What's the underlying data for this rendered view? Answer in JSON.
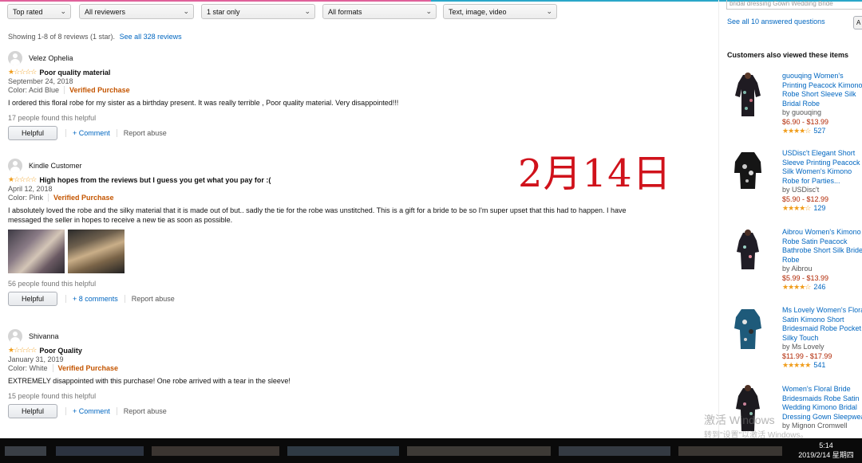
{
  "filters": [
    {
      "label": "Top rated"
    },
    {
      "label": "All reviewers"
    },
    {
      "label": "1 star only"
    },
    {
      "label": "All formats"
    },
    {
      "label": "Text, image, video"
    }
  ],
  "summary": {
    "text": "Showing 1-8 of 8 reviews (1 star).",
    "link": "See all 328 reviews"
  },
  "reviews": [
    {
      "name": "Velez Ophelia",
      "stars": "★☆☆☆☆",
      "title": "Poor quality material",
      "date": "September 24, 2018",
      "color": "Color: Acid Blue",
      "verified": "Verified Purchase",
      "body": "I ordered this floral robe for my sister as a birthday present. It was really terrible , Poor quality material. Very disappointed!!!",
      "helpful_count": "17 people found this helpful",
      "helpful_btn": "Helpful",
      "comment": "+ Comment",
      "report": "Report abuse"
    },
    {
      "name": "Kindle Customer",
      "stars": "★☆☆☆☆",
      "title": "High hopes from the reviews but I guess you get what you pay for :(",
      "date": "April 12, 2018",
      "color": "Color: Pink",
      "verified": "Verified Purchase",
      "body": "I absolutely loved the robe and the silky material that it is made out of but.. sadly the tie for the robe was unstitched. This is a gift for a bride to be so I'm super upset that this had to happen. I have messaged the seller in hopes to receive a new tie as soon as possible.",
      "helpful_count": "56 people found this helpful",
      "helpful_btn": "Helpful",
      "comment": "+ 8 comments",
      "report": "Report abuse"
    },
    {
      "name": "Shivanna",
      "stars": "★☆☆☆☆",
      "title": "Poor Quality",
      "date": "January 31, 2019",
      "color": "Color: White",
      "verified": "Verified Purchase",
      "body": "EXTREMELY disappointed with this purchase! One robe arrived with a tear in the sleeve!",
      "helpful_count": "15 people found this helpful",
      "helpful_btn": "Helpful",
      "comment": "+ Comment",
      "report": "Report abuse"
    }
  ],
  "overlay_date": "2月14日",
  "sidebar": {
    "question_snippet": "bridal dressing Gown Wedding Bride",
    "answered_link": "See all 10 answered questions",
    "ask_btn": "A",
    "heading": "Customers also viewed these items",
    "products": [
      {
        "title": [
          "guouqing Women's",
          "Printing Peacock Kimono",
          "Robe Short Sleeve Silk",
          "Bridal Robe"
        ],
        "by": "by guouqing",
        "price": "$6.90 - $13.99",
        "stars": "★★★★☆",
        "count": "527"
      },
      {
        "title": [
          "USDisc't Elegant Short",
          "Sleeve Printing Peacock",
          "Silk Women's Kimono",
          "Robe for Parties..."
        ],
        "by": "by USDisc't",
        "price": "$5.90 - $12.99",
        "stars": "★★★★☆",
        "count": "129"
      },
      {
        "title": [
          "Aibrou Women's Kimono",
          "Robe Satin Peacock",
          "Bathrobe Short Silk Bride",
          "Robe"
        ],
        "by": "by Aibrou",
        "price": "$5.99 - $13.99",
        "stars": "★★★★☆",
        "count": "246"
      },
      {
        "title": [
          "Ms Lovely Women's Floral",
          "Satin Kimono Short",
          "Bridesmaid Robe Pocket",
          "Silky Touch"
        ],
        "by": "by Ms Lovely",
        "price": "$11.99 - $17.99",
        "stars": "★★★★★",
        "count": "541"
      },
      {
        "title": [
          "Women's Floral Bride",
          "Bridesmaids Robe Satin",
          "Wedding Kimono Bridal",
          "Dressing Gown Sleepwear"
        ],
        "by": "by Mignon Cromwell",
        "price": "",
        "stars": "",
        "count": ""
      }
    ]
  },
  "watermark": {
    "line1": "激活 Windows",
    "line2": "转到\"设置\"以激活 Windows。"
  },
  "clock": {
    "time": "5:14",
    "date": "2019/2/14 星期四"
  },
  "colors": {
    "link": "#0066c0",
    "verified": "#c45500",
    "price": "#b12704",
    "star": "#f09d1c",
    "overlay": "#d0121b"
  }
}
